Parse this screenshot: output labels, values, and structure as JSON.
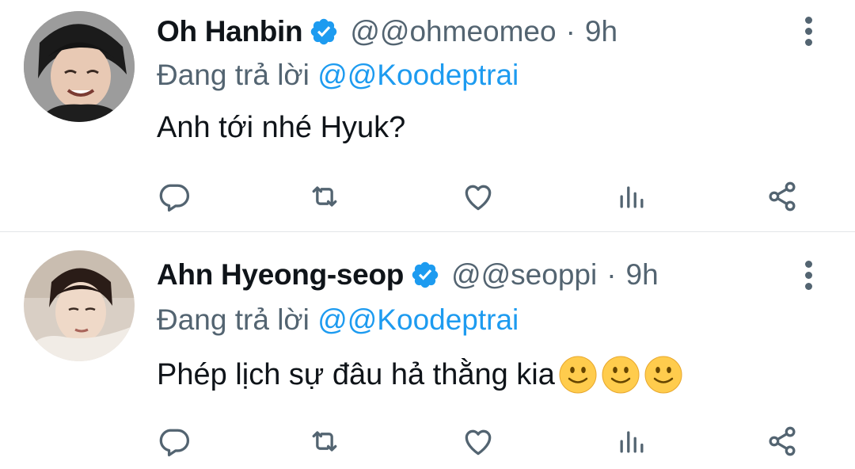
{
  "tweets": [
    {
      "name": "Oh Hanbin",
      "handle": "@@ohmeomeo",
      "separator": "·",
      "time": "9h",
      "replying_prefix": "Đang trả lời ",
      "replying_to": "@@Koodeptrai",
      "text": "Anh tới nhé Hyuk?",
      "emojis": []
    },
    {
      "name": "Ahn Hyeong-seop",
      "handle": "@@seoppi",
      "separator": "·",
      "time": "9h",
      "replying_prefix": "Đang trả lời ",
      "replying_to": "@@Koodeptrai",
      "text": "Phép lịch sự đâu hả thằng kia",
      "emojis": [
        "slightly-smiling-face",
        "slightly-smiling-face",
        "slightly-smiling-face"
      ]
    }
  ],
  "icons": {
    "verified": "verified-badge-icon",
    "more": "more-vertical-icon",
    "reply": "reply-icon",
    "retweet": "retweet-icon",
    "like": "heart-icon",
    "stats": "analytics-icon",
    "share": "share-icon"
  },
  "colors": {
    "accent": "#1d9bf0",
    "text": "#0f1419",
    "secondary": "#536471",
    "divider": "#e3e6e8"
  }
}
